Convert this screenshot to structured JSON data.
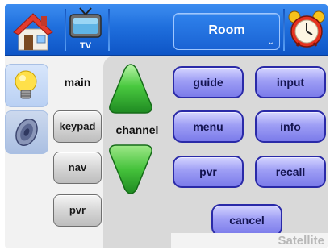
{
  "topbar": {
    "home_icon": "house-icon",
    "tv_icon": "television-icon",
    "tv_label": "TV",
    "room_label": "Room",
    "room_chevron": "⌄",
    "alarm_icon": "alarm-clock-icon"
  },
  "sidebar": {
    "tabs": [
      {
        "icon": "lightbulb-icon"
      },
      {
        "icon": "speaker-icon"
      }
    ],
    "labels": {
      "main": "main",
      "keypad": "keypad",
      "nav": "nav",
      "pvr": "pvr"
    }
  },
  "main": {
    "channel_label": "channel",
    "channel_up_icon": "triangle-up-icon",
    "channel_down_icon": "triangle-down-icon",
    "buttons": {
      "guide": "guide",
      "input": "input",
      "menu": "menu",
      "info": "info",
      "pvr": "pvr",
      "recall": "recall",
      "cancel": "cancel"
    },
    "status": "Satellite"
  },
  "colors": {
    "topbar_blue": "#1f6fdd",
    "pill_purple": "#9e9ef5",
    "pill_border": "#2a2aa8",
    "arrow_green": "#3cb83c",
    "panel_gray": "#d9d9d9"
  }
}
